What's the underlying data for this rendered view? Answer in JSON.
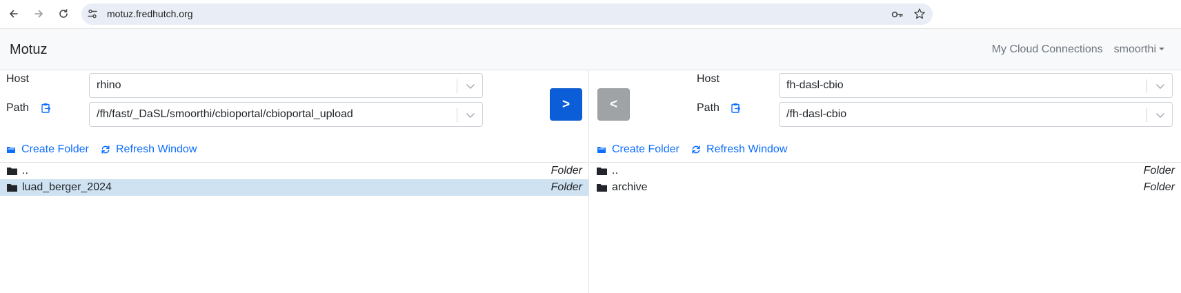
{
  "browser": {
    "url": "motuz.fredhutch.org"
  },
  "app": {
    "brand": "Motuz",
    "nav": {
      "cloud_connections": "My Cloud Connections",
      "user": "smoorthi"
    }
  },
  "left_pane": {
    "host_label": "Host",
    "host_value": "rhino",
    "path_label": "Path",
    "path_value": "/fh/fast/_DaSL/smoorthi/cbioportal/cbioportal_upload",
    "transfer_button": ">",
    "create_folder": "Create Folder",
    "refresh_window": "Refresh Window",
    "files": [
      {
        "name": "..",
        "type": "Folder",
        "selected": false
      },
      {
        "name": "luad_berger_2024",
        "type": "Folder",
        "selected": true
      }
    ]
  },
  "right_pane": {
    "host_label": "Host",
    "host_value": "fh-dasl-cbio",
    "path_label": "Path",
    "path_value": "/fh-dasl-cbio",
    "transfer_button": "<",
    "create_folder": "Create Folder",
    "refresh_window": "Refresh Window",
    "files": [
      {
        "name": "..",
        "type": "Folder",
        "selected": false
      },
      {
        "name": "archive",
        "type": "Folder",
        "selected": false
      }
    ]
  },
  "icons": {
    "back": "arrow-left-icon",
    "forward": "arrow-right-icon",
    "reload": "reload-icon",
    "site_info": "tune-icon",
    "password": "key-icon",
    "bookmark": "star-icon",
    "clipboard": "clipboard-icon",
    "folder": "folder-icon",
    "create_folder": "folder-plus-icon",
    "refresh": "refresh-icon"
  },
  "colors": {
    "primary": "#0d6efd",
    "primary_button": "#0b5ed7",
    "disabled_button": "#a0a3a6",
    "selected_row": "#cfe2f1"
  }
}
